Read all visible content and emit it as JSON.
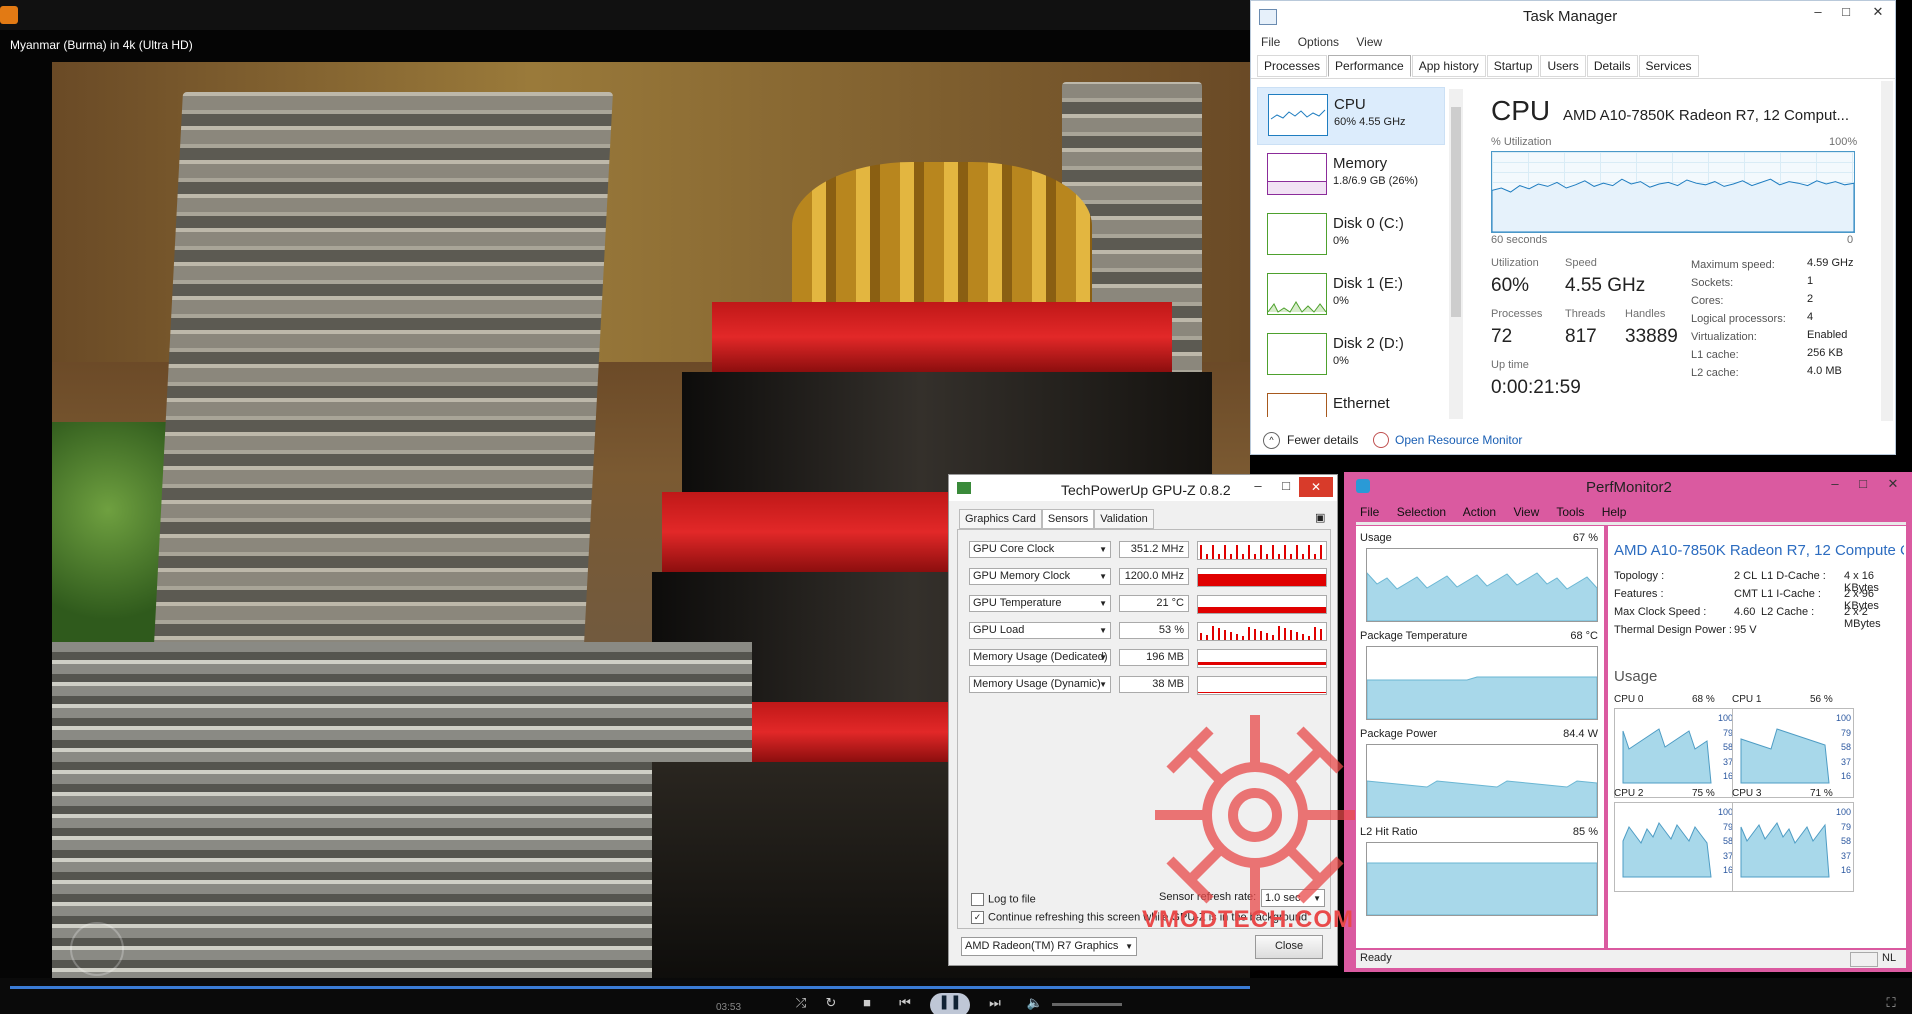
{
  "video": {
    "title": "Myanmar (Burma) in 4k (Ultra HD)",
    "time": "03:53"
  },
  "taskmgr": {
    "title": "Task Manager",
    "menu": [
      "File",
      "Options",
      "View"
    ],
    "tabs": [
      "Processes",
      "Performance",
      "App history",
      "Startup",
      "Users",
      "Details",
      "Services"
    ],
    "active_tab": "Performance",
    "sidebar": [
      {
        "name": "CPU",
        "sub": "60%  4.55 GHz",
        "color": "#1f7dc0"
      },
      {
        "name": "Memory",
        "sub": "1.8/6.9 GB (26%)",
        "color": "#8b2c9a"
      },
      {
        "name": "Disk 0 (C:)",
        "sub": "0%",
        "color": "#4ea12e"
      },
      {
        "name": "Disk 1 (E:)",
        "sub": "0%",
        "color": "#4ea12e"
      },
      {
        "name": "Disk 2 (D:)",
        "sub": "0%",
        "color": "#4ea12e"
      },
      {
        "name": "Ethernet",
        "sub": "",
        "color": "#a7591e"
      }
    ],
    "cpu": {
      "heading": "CPU",
      "model": "AMD A10-7850K Radeon R7, 12 Comput...",
      "util_label": "% Utilization",
      "util_max": "100%",
      "time_span": "60 seconds",
      "zero": "0",
      "stats": {
        "utilization_label": "Utilization",
        "utilization": "60%",
        "speed_label": "Speed",
        "speed": "4.55 GHz",
        "processes_label": "Processes",
        "processes": "72",
        "threads_label": "Threads",
        "threads": "817",
        "handles_label": "Handles",
        "handles": "33889",
        "uptime_label": "Up time",
        "uptime": "0:00:21:59"
      },
      "specs": [
        {
          "k": "Maximum speed:",
          "v": "4.59 GHz"
        },
        {
          "k": "Sockets:",
          "v": "1"
        },
        {
          "k": "Cores:",
          "v": "2"
        },
        {
          "k": "Logical processors:",
          "v": "4"
        },
        {
          "k": "Virtualization:",
          "v": "Enabled"
        },
        {
          "k": "L1 cache:",
          "v": "256 KB"
        },
        {
          "k": "L2 cache:",
          "v": "4.0 MB"
        }
      ],
      "graph": [
        52,
        55,
        50,
        58,
        54,
        60,
        57,
        62,
        55,
        59,
        64,
        57,
        61,
        58,
        66,
        60,
        63,
        56,
        60,
        62,
        58,
        65,
        61,
        59,
        63,
        57,
        60,
        64,
        58,
        62,
        66,
        59,
        63,
        61,
        58,
        64,
        60,
        63,
        59,
        61
      ]
    },
    "fewer_details": "Fewer details",
    "open_resmon": "Open Resource Monitor"
  },
  "gpuz": {
    "title": "TechPowerUp GPU-Z 0.8.2",
    "tabs": [
      "Graphics Card",
      "Sensors",
      "Validation"
    ],
    "active_tab": "Sensors",
    "sensors": [
      {
        "name": "GPU Core Clock",
        "value": "351.2 MHz",
        "style": "spikes"
      },
      {
        "name": "GPU Memory Clock",
        "value": "1200.0 MHz",
        "style": "full"
      },
      {
        "name": "GPU Temperature",
        "value": "21 °C",
        "style": "low"
      },
      {
        "name": "GPU Load",
        "value": "53 %",
        "style": "spikes2"
      },
      {
        "name": "Memory Usage (Dedicated)",
        "value": "196 MB",
        "style": "line"
      },
      {
        "name": "Memory Usage (Dynamic)",
        "value": "38 MB",
        "style": "flat"
      }
    ],
    "log_to_file": "Log to file",
    "refresh_label": "Sensor refresh rate:",
    "refresh_value": "1.0 sec",
    "continue_label": "Continue refreshing this screen while GPU-Z is in the background",
    "gpu_select": "AMD Radeon(TM) R7 Graphics",
    "close": "Close"
  },
  "perfmon": {
    "title": "PerfMonitor2",
    "menu": [
      "File",
      "Selection",
      "Action",
      "View",
      "Tools",
      "Help"
    ],
    "blocks": [
      {
        "name": "Usage",
        "pct": "67 %"
      },
      {
        "name": "Package Temperature",
        "pct": "68 °C"
      },
      {
        "name": "Package Power",
        "pct": "84.4 W"
      },
      {
        "name": "L2 Hit Ratio",
        "pct": "85 %"
      }
    ],
    "cpu_title": "AMD A10-7850K Radeon R7, 12 Compute C",
    "info": [
      {
        "k": "Topology :",
        "v1": "2 CL",
        "k2": "L1 D-Cache :",
        "v2": "4 x 16 KBytes"
      },
      {
        "k": "Features :",
        "v1": "CMT",
        "k2": "L1 I-Cache :",
        "v2": "2 x 96 KBytes"
      },
      {
        "k": "Max Clock Speed :",
        "v1": "4.60",
        "k2": "L2 Cache :",
        "v2": "2 x 2 MBytes"
      },
      {
        "k": "Thermal Design Power :",
        "v1": "95 V",
        "k2": "",
        "v2": ""
      }
    ],
    "usage_heading": "Usage",
    "cores": [
      {
        "name": "CPU 0",
        "pct": "68 %"
      },
      {
        "name": "CPU 1",
        "pct": "56 %"
      },
      {
        "name": "CPU 2",
        "pct": "75 %"
      },
      {
        "name": "CPU 3",
        "pct": "71 %"
      }
    ],
    "ticks": [
      "100",
      "79",
      "58",
      "37",
      "16"
    ],
    "status": "Ready",
    "status_right": "NL"
  },
  "watermark": "VMODTECH.COM",
  "colors": {
    "accent_blue": "#1f7dc0",
    "perfmon_pink": "#da5aa0",
    "gpuz_red": "#e00000",
    "graph_fill": "#a8d8ea"
  }
}
